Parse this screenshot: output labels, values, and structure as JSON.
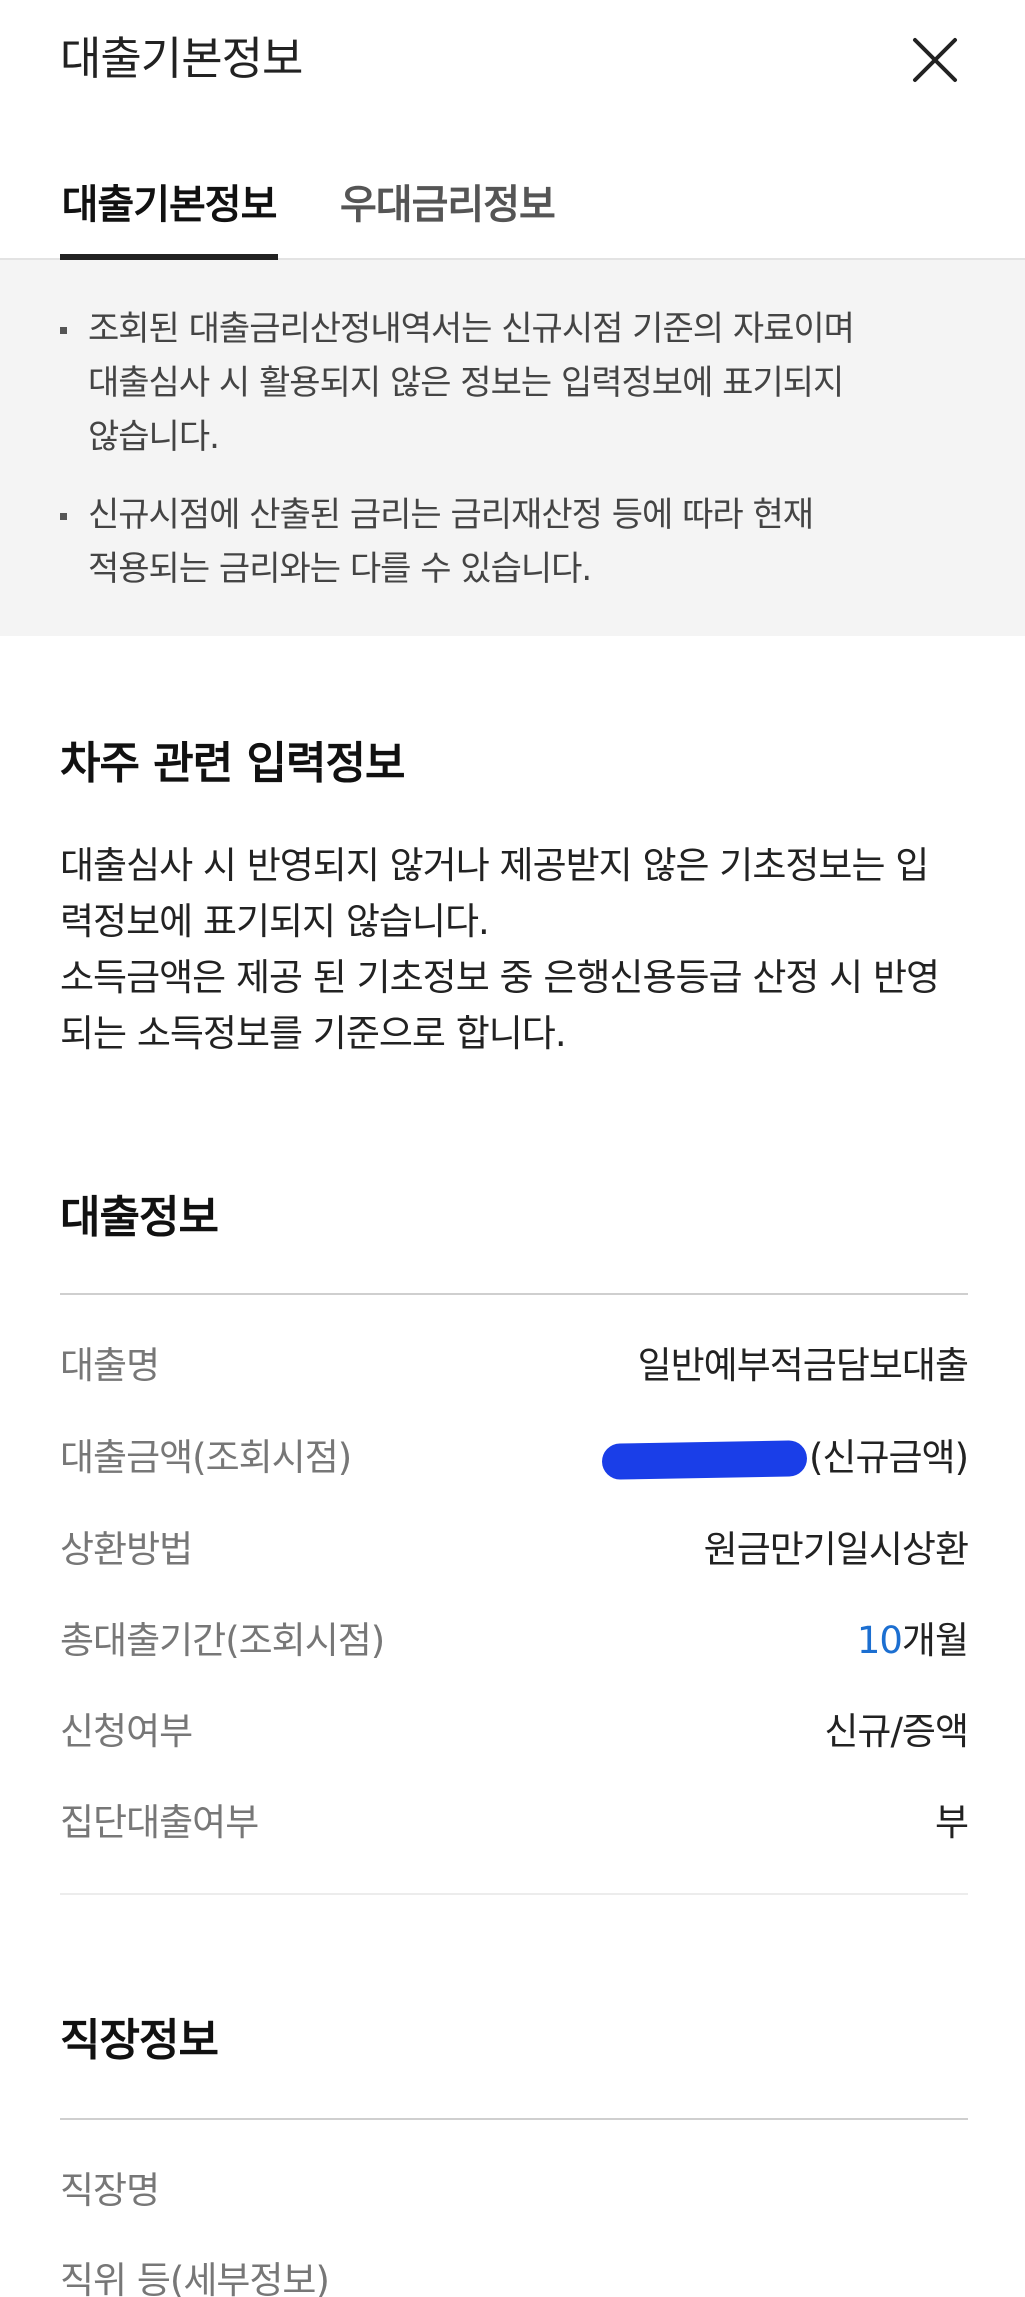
{
  "header": {
    "title": "대출기본정보"
  },
  "tabs": [
    {
      "label": "대출기본정보",
      "active": true
    },
    {
      "label": "우대금리정보",
      "active": false
    }
  ],
  "notice": {
    "items": [
      "조회된 대출금리산정내역서는 신규시점 기준의 자료이며\n대출심사 시 활용되지 않은 정보는 입력정보에 표기되지\n않습니다.",
      "신규시점에 산출된 금리는 금리재산정 등에 따라 현재\n적용되는 금리와는 다를 수 있습니다."
    ]
  },
  "borrower": {
    "title": "차주 관련 입력정보",
    "description": "대출심사 시 반영되지 않거나 제공받지 않은 기초정보는 입\n력정보에 표기되지 않습니다.\n소득금액은 제공 된 기초정보 중 은행신용등급 산정 시 반영\n되는 소득정보를 기준으로 합니다."
  },
  "loan": {
    "title": "대출정보",
    "rows": [
      {
        "label": "대출명",
        "value": "일반예부적금담보대출"
      },
      {
        "label": "대출금액(조회시점)",
        "value": "(신규금액)"
      },
      {
        "label": "상환방법",
        "value": "원금만기일시상환"
      },
      {
        "label": "총대출기간(조회시점)",
        "value_number": "10",
        "value_unit": "개월"
      },
      {
        "label": "신청여부",
        "value": "신규/증액"
      },
      {
        "label": "집단대출여부",
        "value": "부"
      }
    ]
  },
  "job": {
    "title": "직장정보",
    "rows": [
      {
        "label": "직장명"
      },
      {
        "label": "직위 등(세부정보)"
      }
    ]
  },
  "colors": {
    "accent": "#1c6fd1",
    "redaction": "#1a3ee8",
    "notice_bg": "#f4f4f4"
  }
}
